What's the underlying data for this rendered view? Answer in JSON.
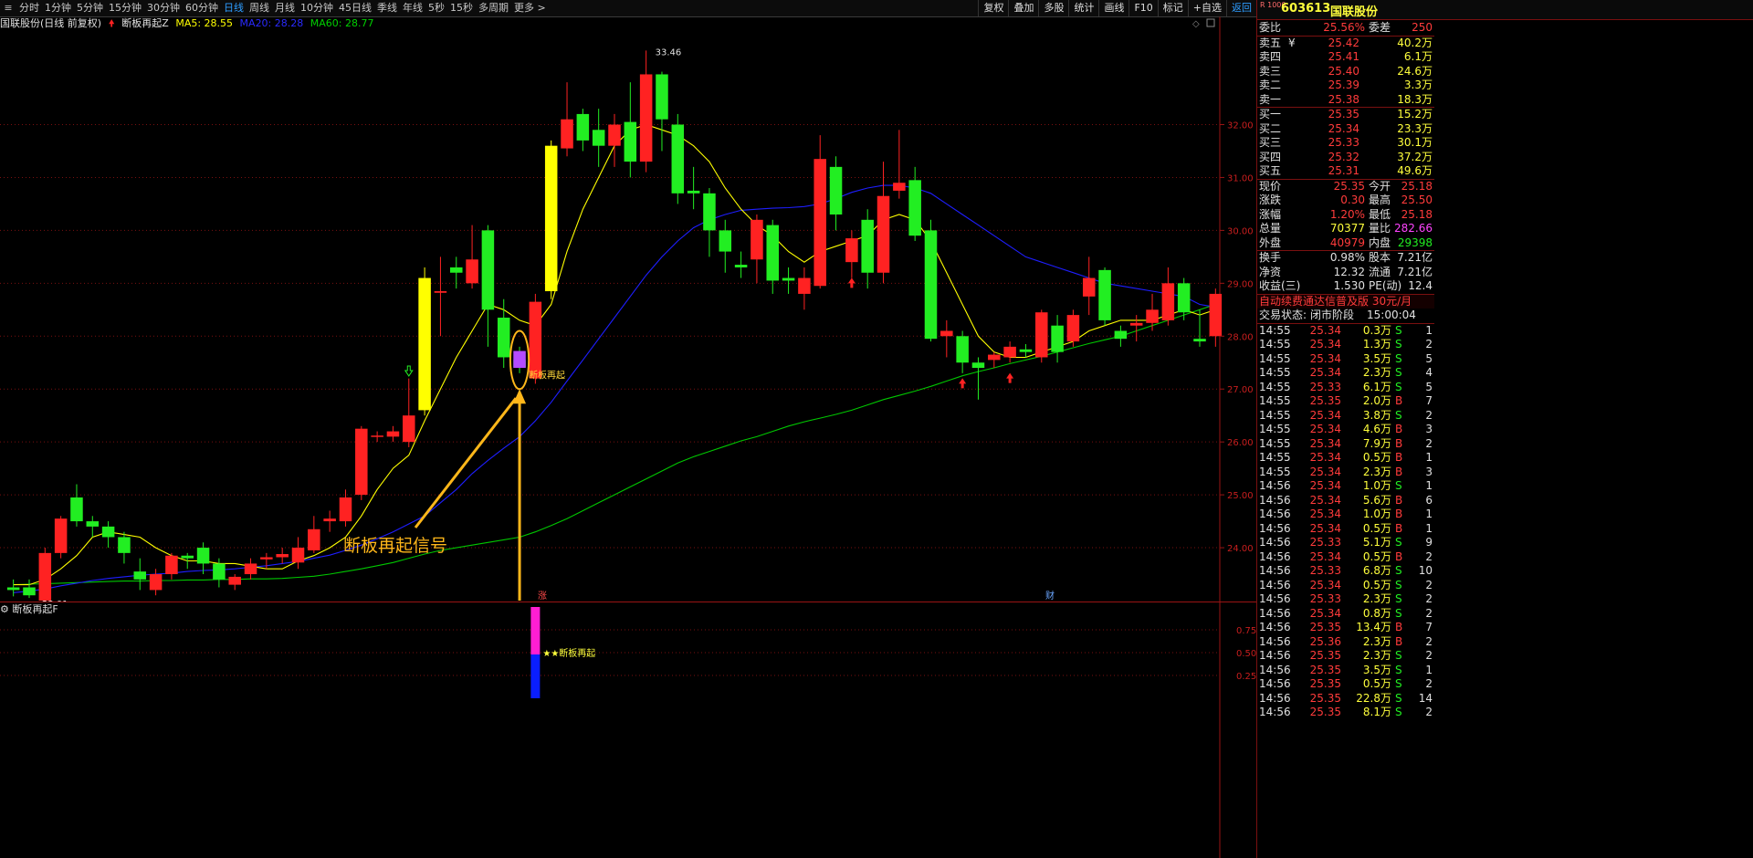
{
  "toolbar": {
    "periods": [
      "分时",
      "1分钟",
      "5分钟",
      "15分钟",
      "30分钟",
      "60分钟",
      "日线",
      "周线",
      "月线",
      "10分钟",
      "45日线",
      "季线",
      "年线",
      "5秒",
      "15秒",
      "多周期",
      "更多 >"
    ],
    "active_period": "日线",
    "tools": [
      "复权",
      "叠加",
      "多股",
      "统计",
      "画线",
      "F10",
      "标记",
      "+自选",
      "返回"
    ]
  },
  "legend": {
    "stock": "国联股份(日线 前复权)",
    "indicator": "断板再起Z",
    "ma5": "MA5: 28.55",
    "ma20": "MA20: 28.28",
    "ma60": "MA60: 28.77"
  },
  "colors": {
    "up": "#ff2222",
    "down": "#22ee22",
    "signal_bar": "#ffff00",
    "ma5": "#ffff00",
    "ma20": "#1e1eff",
    "ma60": "#00c800",
    "annotation": "#ffb71a",
    "mark": "#b44bff"
  },
  "chart_data": {
    "type": "candlestick",
    "title": "国联股份(日线 前复权)",
    "ylim": [
      23,
      33.7
    ],
    "y_ticks": [
      24.0,
      25.0,
      26.0,
      27.0,
      28.0,
      29.0,
      30.0,
      31.0,
      32.0
    ],
    "candles": [
      [
        23.25,
        23.2,
        23.4,
        23.08
      ],
      [
        23.25,
        23.1,
        23.4,
        23.05
      ],
      [
        23.0,
        23.9,
        24.0,
        22.9
      ],
      [
        23.9,
        24.55,
        24.6,
        23.8
      ],
      [
        24.95,
        24.5,
        25.2,
        24.4
      ],
      [
        24.5,
        24.4,
        24.6,
        24.2
      ],
      [
        24.4,
        24.2,
        24.5,
        24.0
      ],
      [
        24.2,
        23.9,
        24.3,
        23.7
      ],
      [
        23.55,
        23.4,
        23.8,
        23.2
      ],
      [
        23.2,
        23.5,
        23.6,
        23.1
      ],
      [
        23.5,
        23.85,
        23.9,
        23.4
      ],
      [
        23.85,
        23.8,
        23.9,
        23.6
      ],
      [
        24.0,
        23.7,
        24.1,
        23.5
      ],
      [
        23.7,
        23.4,
        23.8,
        23.25
      ],
      [
        23.3,
        23.45,
        23.5,
        23.2
      ],
      [
        23.5,
        23.7,
        23.8,
        23.4
      ],
      [
        23.78,
        23.82,
        23.9,
        23.6
      ],
      [
        23.82,
        23.88,
        24.0,
        23.7
      ],
      [
        23.72,
        24.0,
        24.2,
        23.6
      ],
      [
        23.95,
        24.35,
        24.6,
        23.9
      ],
      [
        24.5,
        24.55,
        24.7,
        24.3
      ],
      [
        24.5,
        24.95,
        25.1,
        24.4
      ],
      [
        25.0,
        26.25,
        26.3,
        24.9
      ],
      [
        26.1,
        26.12,
        26.2,
        26.0
      ],
      [
        26.1,
        26.2,
        26.3,
        26.0
      ],
      [
        26.0,
        26.5,
        27.2,
        25.9
      ],
      [
        26.6,
        29.1,
        29.3,
        26.5
      ],
      [
        28.82,
        28.85,
        29.5,
        28.0
      ],
      [
        29.3,
        29.2,
        29.5,
        28.9
      ],
      [
        29.0,
        29.45,
        30.1,
        28.9
      ],
      [
        30.0,
        28.5,
        30.1,
        27.8
      ],
      [
        28.35,
        27.6,
        28.7,
        27.4
      ],
      [
        27.55,
        27.41,
        27.8,
        27.3
      ],
      [
        27.2,
        28.65,
        28.8,
        27.1
      ],
      [
        28.85,
        31.6,
        31.7,
        28.7
      ],
      [
        31.55,
        32.1,
        32.8,
        31.4
      ],
      [
        32.2,
        31.7,
        32.3,
        31.5
      ],
      [
        31.9,
        31.6,
        32.3,
        31.2
      ],
      [
        31.6,
        32.0,
        32.2,
        31.2
      ],
      [
        32.05,
        31.3,
        32.8,
        31.0
      ],
      [
        31.3,
        32.95,
        33.4,
        31.1
      ],
      [
        32.95,
        32.1,
        33.0,
        31.5
      ],
      [
        32.0,
        30.7,
        32.2,
        30.5
      ],
      [
        30.75,
        30.7,
        31.2,
        30.4
      ],
      [
        30.7,
        30.0,
        30.8,
        29.5
      ],
      [
        30.0,
        29.6,
        30.2,
        29.2
      ],
      [
        29.35,
        29.3,
        29.6,
        29.1
      ],
      [
        29.45,
        30.2,
        30.3,
        29.0
      ],
      [
        30.1,
        29.05,
        30.2,
        28.8
      ],
      [
        29.1,
        29.05,
        29.3,
        28.8
      ],
      [
        28.8,
        29.1,
        29.3,
        28.5
      ],
      [
        28.95,
        31.35,
        31.8,
        28.9
      ],
      [
        31.2,
        30.3,
        31.4,
        30.0
      ],
      [
        29.4,
        29.85,
        30.0,
        29.1
      ],
      [
        30.2,
        29.2,
        30.4,
        28.9
      ],
      [
        29.2,
        30.65,
        31.3,
        29.0
      ],
      [
        30.75,
        30.9,
        31.9,
        30.6
      ],
      [
        30.95,
        29.9,
        31.2,
        29.8
      ],
      [
        30.0,
        27.95,
        30.2,
        27.9
      ],
      [
        28.0,
        28.1,
        28.3,
        27.6
      ],
      [
        28.0,
        27.5,
        28.1,
        27.3
      ],
      [
        27.5,
        27.4,
        27.6,
        26.8
      ],
      [
        27.55,
        27.65,
        27.7,
        27.4
      ],
      [
        27.6,
        27.8,
        27.9,
        27.5
      ],
      [
        27.75,
        27.7,
        27.85,
        27.6
      ],
      [
        27.6,
        28.45,
        28.5,
        27.5
      ],
      [
        28.2,
        27.7,
        28.4,
        27.5
      ],
      [
        27.9,
        28.4,
        28.5,
        27.8
      ],
      [
        28.75,
        29.1,
        29.5,
        28.4
      ],
      [
        29.25,
        28.3,
        29.3,
        28.2
      ],
      [
        28.1,
        27.95,
        28.2,
        27.8
      ],
      [
        28.2,
        28.25,
        28.4,
        27.9
      ],
      [
        28.25,
        28.5,
        28.8,
        28.1
      ],
      [
        28.3,
        29.0,
        29.3,
        28.2
      ],
      [
        29.0,
        28.45,
        29.1,
        28.3
      ],
      [
        27.95,
        27.9,
        28.5,
        27.8
      ],
      [
        28.0,
        28.8,
        28.9,
        27.8
      ]
    ],
    "signal_bar_indices": [
      26,
      34
    ],
    "ma5": [
      23.3,
      23.3,
      23.4,
      23.6,
      23.85,
      24.2,
      24.3,
      24.25,
      24.2,
      24.0,
      23.85,
      23.75,
      23.75,
      23.7,
      23.7,
      23.65,
      23.6,
      23.6,
      23.75,
      23.85,
      24.0,
      24.2,
      24.6,
      25.1,
      25.5,
      25.75,
      26.4,
      27.0,
      27.6,
      28.1,
      28.6,
      28.5,
      28.3,
      28.2,
      28.6,
      29.6,
      30.4,
      31.0,
      31.6,
      31.9,
      32.0,
      31.9,
      31.8,
      31.6,
      31.3,
      30.8,
      30.4,
      30.1,
      29.9,
      29.6,
      29.4,
      29.6,
      29.7,
      29.8,
      29.9,
      30.2,
      30.3,
      30.2,
      29.8,
      29.2,
      28.6,
      28.0,
      27.7,
      27.6,
      27.6,
      27.7,
      27.8,
      27.9,
      28.1,
      28.2,
      28.3,
      28.3,
      28.3,
      28.4,
      28.5,
      28.4,
      28.5
    ],
    "ma20": [
      23.15,
      23.18,
      23.22,
      23.28,
      23.33,
      23.38,
      23.42,
      23.45,
      23.48,
      23.5,
      23.52,
      23.55,
      23.57,
      23.58,
      23.6,
      23.63,
      23.66,
      23.7,
      23.74,
      23.8,
      23.86,
      23.95,
      24.05,
      24.17,
      24.3,
      24.45,
      24.6,
      24.85,
      25.1,
      25.4,
      25.65,
      25.88,
      26.1,
      26.4,
      26.75,
      27.15,
      27.55,
      27.95,
      28.35,
      28.75,
      29.15,
      29.5,
      29.8,
      30.05,
      30.2,
      30.3,
      30.38,
      30.4,
      30.42,
      30.43,
      30.45,
      30.5,
      30.6,
      30.72,
      30.8,
      30.85,
      30.85,
      30.8,
      30.7,
      30.5,
      30.3,
      30.1,
      29.9,
      29.7,
      29.5,
      29.4,
      29.3,
      29.2,
      29.1,
      29.0,
      28.95,
      28.9,
      28.85,
      28.8,
      28.75,
      28.6,
      28.55
    ],
    "ma60": [
      23.3,
      23.31,
      23.32,
      23.33,
      23.34,
      23.35,
      23.36,
      23.37,
      23.37,
      23.38,
      23.38,
      23.39,
      23.39,
      23.4,
      23.4,
      23.41,
      23.41,
      23.42,
      23.44,
      23.46,
      23.5,
      23.55,
      23.6,
      23.66,
      23.72,
      23.8,
      23.88,
      23.95,
      24.0,
      24.05,
      24.1,
      24.15,
      24.2,
      24.3,
      24.42,
      24.55,
      24.7,
      24.85,
      25.0,
      25.15,
      25.3,
      25.45,
      25.6,
      25.72,
      25.82,
      25.92,
      26.02,
      26.1,
      26.2,
      26.3,
      26.38,
      26.45,
      26.52,
      26.6,
      26.7,
      26.8,
      26.88,
      26.96,
      27.05,
      27.15,
      27.25,
      27.33,
      27.4,
      27.48,
      27.55,
      27.62,
      27.7,
      27.78,
      27.86,
      27.93,
      28.0,
      28.1,
      28.2,
      28.3,
      28.4,
      28.5,
      28.6
    ],
    "labels": {
      "high_label": "33.46",
      "low_label": "23.01",
      "signal_text": "断板再起",
      "annotation": "断板再起信号",
      "zhang": "涨",
      "cai": "财"
    },
    "sub_chart": {
      "title": "断板再起F",
      "ylim": [
        0,
        1
      ],
      "y_ticks": [
        0.25,
        0.5,
        0.75
      ],
      "bar_index": 33,
      "bar_value": 1,
      "label": "★★断板再起"
    }
  },
  "quote": {
    "logo": "R 1000",
    "code": "603613",
    "name": "国联股份",
    "weibi_label": "委比",
    "weibi": "25.56%",
    "weicha_label": "委差",
    "weicha": "250",
    "asks": [
      {
        "label": "卖五",
        "mark": "¥",
        "price": "25.42",
        "vol": "40.2万"
      },
      {
        "label": "卖四",
        "mark": "",
        "price": "25.41",
        "vol": "6.1万"
      },
      {
        "label": "卖三",
        "mark": "",
        "price": "25.40",
        "vol": "24.6万"
      },
      {
        "label": "卖二",
        "mark": "",
        "price": "25.39",
        "vol": "3.3万"
      },
      {
        "label": "卖一",
        "mark": "",
        "price": "25.38",
        "vol": "18.3万"
      }
    ],
    "bids": [
      {
        "label": "买一",
        "price": "25.35",
        "vol": "15.2万"
      },
      {
        "label": "买二",
        "price": "25.34",
        "vol": "23.3万"
      },
      {
        "label": "买三",
        "price": "25.33",
        "vol": "30.1万"
      },
      {
        "label": "买四",
        "price": "25.32",
        "vol": "37.2万"
      },
      {
        "label": "买五",
        "price": "25.31",
        "vol": "49.6万"
      }
    ],
    "stats_a": [
      {
        "l1": "现价",
        "v1": "25.35",
        "c1": "#ff3b3b",
        "l2": "今开",
        "v2": "25.18",
        "c2": "#ff3b3b"
      },
      {
        "l1": "涨跌",
        "v1": "0.30",
        "c1": "#ff3b3b",
        "l2": "最高",
        "v2": "25.50",
        "c2": "#ff3b3b"
      },
      {
        "l1": "涨幅",
        "v1": "1.20%",
        "c1": "#ff3b3b",
        "l2": "最低",
        "v2": "25.18",
        "c2": "#ff3b3b"
      },
      {
        "l1": "总量",
        "v1": "70377",
        "c1": "#ffff3c",
        "l2": "量比",
        "v2": "282.66",
        "c2": "#ff44ff"
      },
      {
        "l1": "外盘",
        "v1": "40979",
        "c1": "#ff3b3b",
        "l2": "内盘",
        "v2": "29398",
        "c2": "#22ee22"
      }
    ],
    "stats_b": [
      {
        "l1": "换手",
        "v1": "0.98%",
        "c1": "#e0e0e0",
        "l2": "股本",
        "v2": "7.21亿",
        "c2": "#e0e0e0"
      },
      {
        "l1": "净资",
        "v1": "12.32",
        "c1": "#e0e0e0",
        "l2": "流通",
        "v2": "7.21亿",
        "c2": "#e0e0e0"
      },
      {
        "l1": "收益(三)",
        "v1": "1.530",
        "c1": "#e0e0e0",
        "l2": "PE(动)",
        "v2": "12.4",
        "c2": "#e0e0e0"
      }
    ],
    "ad": "自动续费通达信普及版  30元/月",
    "status_label": "交易状态:",
    "status": "闭市阶段",
    "status_time": "15:00:04",
    "ticks": [
      [
        "14:55",
        "25.34",
        "0.3万",
        "S",
        "1"
      ],
      [
        "14:55",
        "25.34",
        "1.3万",
        "S",
        "2"
      ],
      [
        "14:55",
        "25.34",
        "3.5万",
        "S",
        "5"
      ],
      [
        "14:55",
        "25.34",
        "2.3万",
        "S",
        "4"
      ],
      [
        "14:55",
        "25.33",
        "6.1万",
        "S",
        "5"
      ],
      [
        "14:55",
        "25.35",
        "2.0万",
        "B",
        "7"
      ],
      [
        "14:55",
        "25.34",
        "3.8万",
        "S",
        "2"
      ],
      [
        "14:55",
        "25.34",
        "4.6万",
        "B",
        "3"
      ],
      [
        "14:55",
        "25.34",
        "7.9万",
        "B",
        "2"
      ],
      [
        "14:55",
        "25.34",
        "0.5万",
        "B",
        "1"
      ],
      [
        "14:55",
        "25.34",
        "2.3万",
        "B",
        "3"
      ],
      [
        "14:56",
        "25.34",
        "1.0万",
        "S",
        "1"
      ],
      [
        "14:56",
        "25.34",
        "5.6万",
        "B",
        "6"
      ],
      [
        "14:56",
        "25.34",
        "1.0万",
        "B",
        "1"
      ],
      [
        "14:56",
        "25.34",
        "0.5万",
        "B",
        "1"
      ],
      [
        "14:56",
        "25.33",
        "5.1万",
        "S",
        "9"
      ],
      [
        "14:56",
        "25.34",
        "0.5万",
        "B",
        "2"
      ],
      [
        "14:56",
        "25.33",
        "6.8万",
        "S",
        "10"
      ],
      [
        "14:56",
        "25.34",
        "0.5万",
        "S",
        "2"
      ],
      [
        "14:56",
        "25.33",
        "2.3万",
        "S",
        "2"
      ],
      [
        "14:56",
        "25.34",
        "0.8万",
        "S",
        "2"
      ],
      [
        "14:56",
        "25.35",
        "13.4万",
        "B",
        "7"
      ],
      [
        "14:56",
        "25.36",
        "2.3万",
        "B",
        "2"
      ],
      [
        "14:56",
        "25.35",
        "2.3万",
        "S",
        "2"
      ],
      [
        "14:56",
        "25.35",
        "3.5万",
        "S",
        "1"
      ],
      [
        "14:56",
        "25.35",
        "0.5万",
        "S",
        "2"
      ],
      [
        "14:56",
        "25.35",
        "22.8万",
        "S",
        "14"
      ],
      [
        "14:56",
        "25.35",
        "8.1万",
        "S",
        "2"
      ]
    ]
  }
}
